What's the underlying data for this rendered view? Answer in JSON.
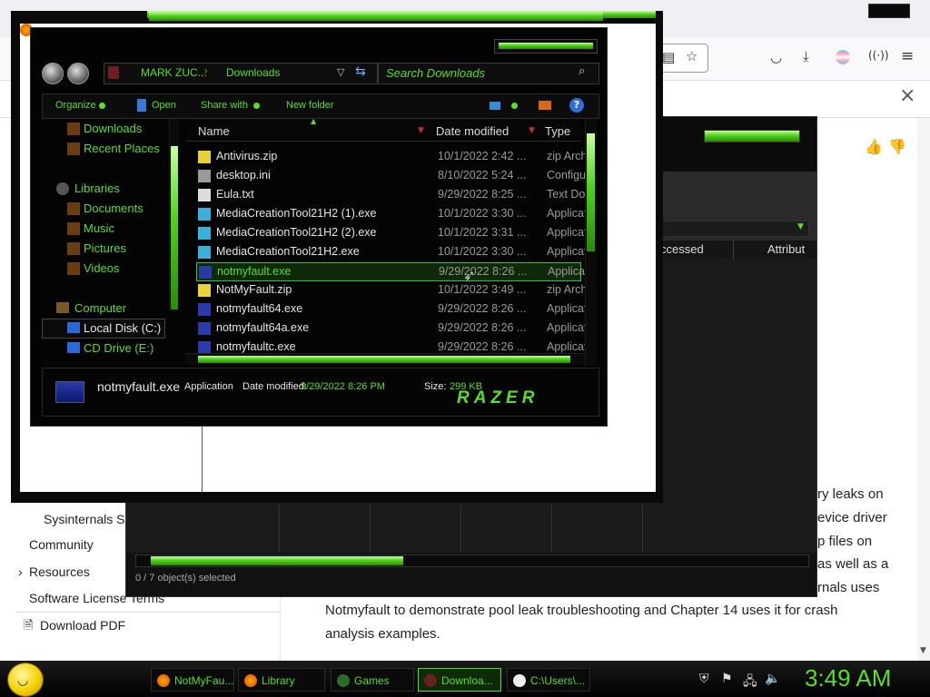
{
  "browser": {
    "article_lines": [
      "ry leaks on",
      "evice driver",
      "p files on",
      "as well as a",
      "rnals uses",
      "Notmyfault to demonstrate pool leak troubleshooting and Chapter 14 uses it for crash",
      "analysis examples."
    ],
    "nav": {
      "sysinternals": "Sysinternals Su",
      "community": "Community",
      "resources": "Resources",
      "license": "Software License Terms",
      "download_pdf": "Download PDF"
    }
  },
  "back_window": {
    "col_accessed": "ccessed",
    "col_attrib": "Attribut",
    "status": "0 / 7 object(s) selected"
  },
  "explorer": {
    "breadcrumb_user": "MARK ZUC...",
    "breadcrumb_folder": "Downloads",
    "search_placeholder": "Search Downloads",
    "commands": {
      "organize": "Organize",
      "open": "Open",
      "share": "Share with",
      "new_folder": "New folder"
    },
    "nav_items": [
      {
        "label": "Downloads",
        "icon": "downloads-folder-icon"
      },
      {
        "label": "Recent Places",
        "icon": "recent-places-icon"
      },
      {
        "label": "Libraries",
        "icon": "libraries-icon"
      },
      {
        "label": "Documents",
        "icon": "documents-icon"
      },
      {
        "label": "Music",
        "icon": "music-icon"
      },
      {
        "label": "Pictures",
        "icon": "pictures-icon"
      },
      {
        "label": "Videos",
        "icon": "videos-icon"
      },
      {
        "label": "Computer",
        "icon": "computer-icon"
      },
      {
        "label": "Local Disk (C:)",
        "icon": "drive-icon"
      },
      {
        "label": "CD Drive (E:)",
        "icon": "cd-drive-icon"
      }
    ],
    "columns": {
      "name": "Name",
      "date": "Date modified",
      "type": "Type"
    },
    "files": [
      {
        "name": "Antivirus.zip",
        "date": "10/1/2022 2:42 ...",
        "type": "zip Arch",
        "icon": "zip-icon"
      },
      {
        "name": "desktop.ini",
        "date": "8/10/2022 5:24 ...",
        "type": "Configu",
        "icon": "settings-file-icon"
      },
      {
        "name": "Eula.txt",
        "date": "9/29/2022 8:25 ...",
        "type": "Text Do",
        "icon": "text-file-icon"
      },
      {
        "name": "MediaCreationTool21H2 (1).exe",
        "date": "10/1/2022 3:30 ...",
        "type": "Applicat",
        "icon": "installer-icon"
      },
      {
        "name": "MediaCreationTool21H2 (2).exe",
        "date": "10/1/2022 3:31 ...",
        "type": "Applicat",
        "icon": "installer-icon"
      },
      {
        "name": "MediaCreationTool21H2.exe",
        "date": "10/1/2022 3:30 ...",
        "type": "Applicat",
        "icon": "installer-icon"
      },
      {
        "name": "notmyfault.exe",
        "date": "9/29/2022 8:26 ...",
        "type": "Applicat",
        "icon": "exe-icon"
      },
      {
        "name": "NotMyFault.zip",
        "date": "10/1/2022 3:49 ...",
        "type": "zip Arch",
        "icon": "zip-icon"
      },
      {
        "name": "notmyfault64.exe",
        "date": "9/29/2022 8:26 ...",
        "type": "Applicat",
        "icon": "exe-icon"
      },
      {
        "name": "notmyfault64a.exe",
        "date": "9/29/2022 8:26 ...",
        "type": "Applicat",
        "icon": "exe-icon"
      },
      {
        "name": "notmyfaultc.exe",
        "date": "9/29/2022 8:26 ...",
        "type": "Applicat",
        "icon": "exe-icon"
      }
    ],
    "selected_index": 6,
    "details": {
      "name": "notmyfault.exe",
      "type": "Application",
      "date_label": "Date modified:",
      "date_value": "9/29/2022 8:26 PM",
      "size_label": "Size:",
      "size_value": "299 KB",
      "brand": "RAZER"
    }
  },
  "taskbar": {
    "items": [
      {
        "label": "NotMyFau...",
        "icon": "firefox-icon"
      },
      {
        "label": "Library",
        "icon": "firefox-icon"
      },
      {
        "label": "Games",
        "icon": "games-icon"
      },
      {
        "label": "Downloa...",
        "icon": "explorer-icon"
      },
      {
        "label": "C:\\Users\\...",
        "icon": "7zip-icon"
      }
    ],
    "active_index": 3,
    "clock": "3:49 AM"
  },
  "colors": {
    "accent": "#5cdc2c",
    "window_bg": "#030303"
  }
}
